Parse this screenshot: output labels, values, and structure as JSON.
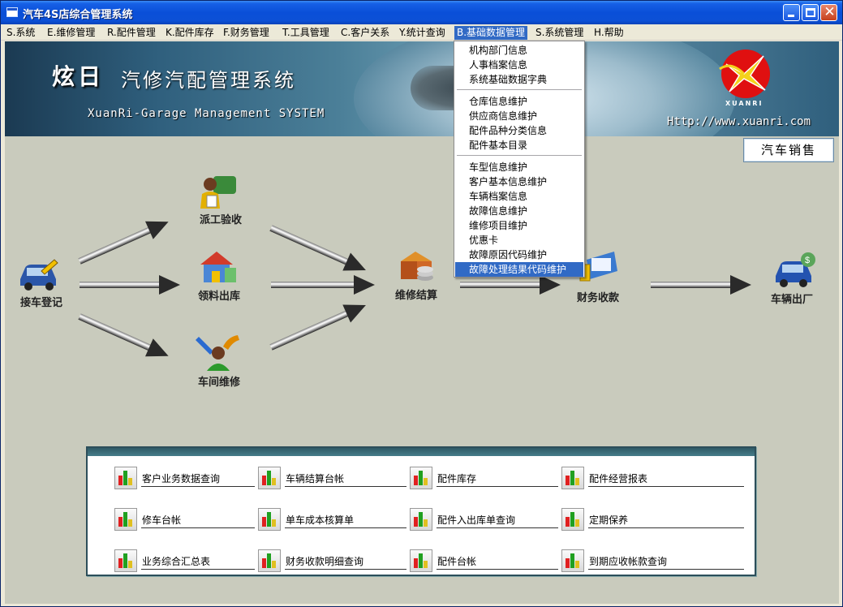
{
  "window": {
    "title": "汽车4S店综合管理系统"
  },
  "menubar": [
    {
      "label": "S.系统"
    },
    {
      "label": "E.维修管理"
    },
    {
      "label": "R.配件管理"
    },
    {
      "label": "K.配件库存"
    },
    {
      "label": "F.财务管理"
    },
    {
      "label": "T.工具管理"
    },
    {
      "label": "C.客户关系"
    },
    {
      "label": "Y.统计查询"
    },
    {
      "label": "B.基础数据管理",
      "active": true
    },
    {
      "label": "S.系统管理"
    },
    {
      "label": "H.帮助"
    }
  ],
  "dropdown": {
    "groups": [
      [
        "机构部门信息",
        "人事档案信息",
        "系统基础数据字典"
      ],
      [
        "仓库信息维护",
        "供应商信息维护",
        "配件品种分类信息",
        "配件基本目录"
      ],
      [
        "车型信息维护",
        "客户基本信息维护",
        "车辆档案信息",
        "故障信息维护",
        "维修项目维护",
        "优惠卡",
        "故障原因代码维护",
        "故障处理结果代码维护"
      ]
    ],
    "highlighted": "故障处理结果代码维护"
  },
  "banner": {
    "zh_title_a": "炫日",
    "zh_title_b": "汽修汽配管理系统",
    "en_title": "XuanRi-Garage Management SYSTEM",
    "url": "Http://www.xuanri.com",
    "logo_text": "XUANRI"
  },
  "sales_button": {
    "label": "汽车销售"
  },
  "flow": {
    "reception": "接车登记",
    "dispatch": "派工验收",
    "parts_out": "领料出库",
    "workshop": "车间维修",
    "settlement": "维修结算",
    "finance": "财务收款",
    "exit": "车辆出厂"
  },
  "reports": {
    "row1": [
      "客户业务数据查询",
      "车辆结算台帐",
      "配件库存",
      "配件经营报表"
    ],
    "row2": [
      "修车台帐",
      "单车成本核算单",
      "配件入出库单查询",
      "定期保养"
    ],
    "row3": [
      "业务综合汇总表",
      "财务收款明细查询",
      "配件台帐",
      "到期应收帐款查询"
    ]
  },
  "colors": {
    "accent": "#316ac5",
    "titlebar": "#0a4fd8",
    "background": "#c9cbbd"
  }
}
